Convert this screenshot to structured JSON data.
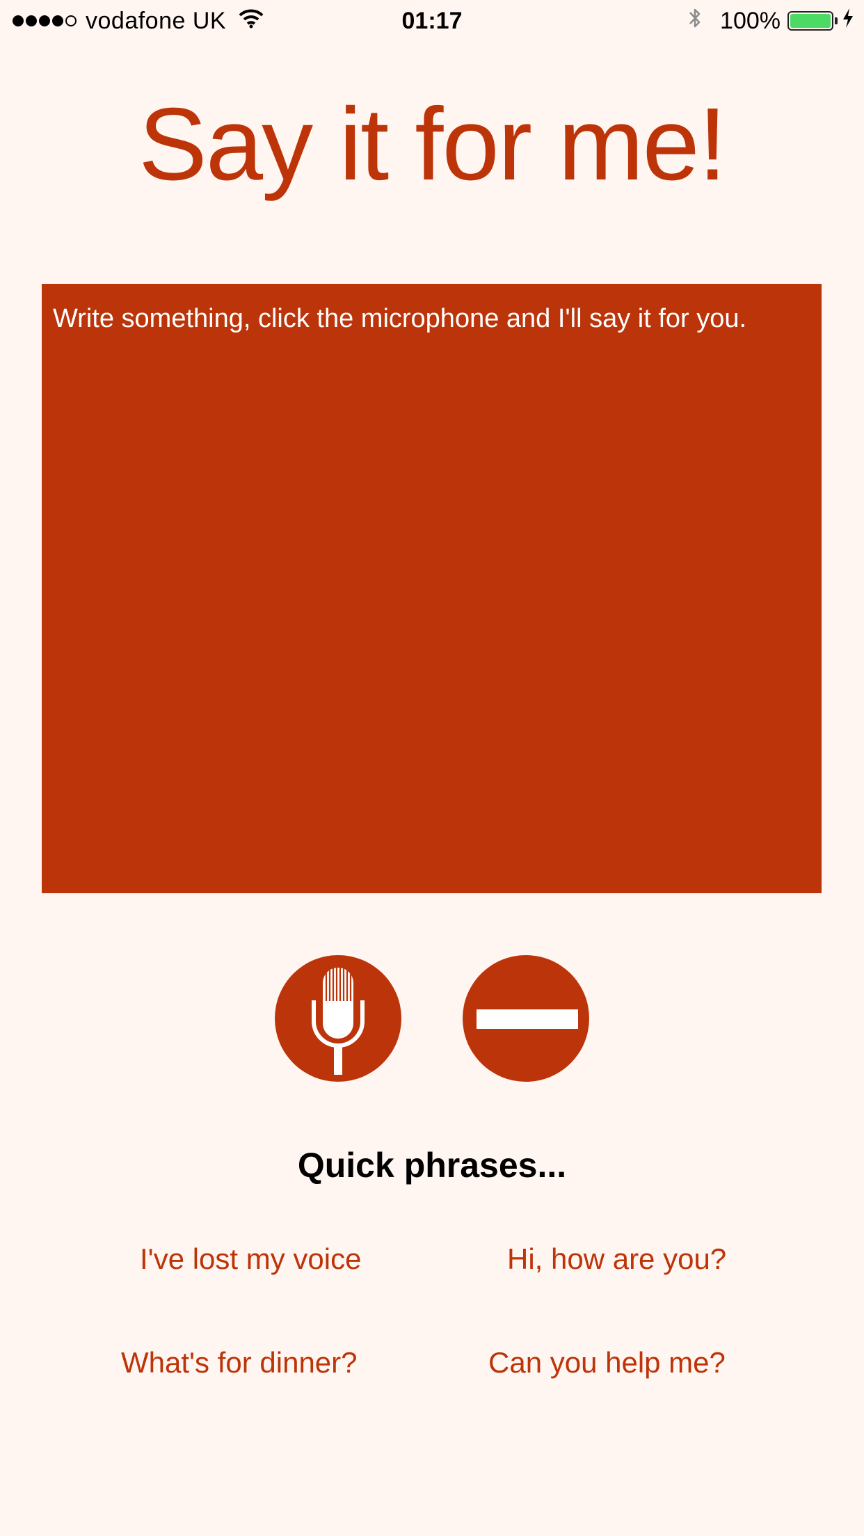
{
  "status_bar": {
    "carrier": "vodafone UK",
    "time": "01:17",
    "battery": "100%",
    "signal_bars_filled": 4,
    "signal_bars_total": 5
  },
  "title": "Say it for me!",
  "input": {
    "placeholder": "Write something, click the microphone and I'll say it for you.",
    "value": ""
  },
  "buttons": {
    "speak_icon": "microphone-icon",
    "clear_icon": "minus-icon"
  },
  "quick_phrases": {
    "heading": "Quick phrases...",
    "items": [
      "I've lost my voice",
      "Hi, how are you?",
      "What's for dinner?",
      "Can you help me?"
    ]
  },
  "colors": {
    "accent": "#bc3409",
    "background": "#fff5f1",
    "battery": "#4cd964"
  }
}
